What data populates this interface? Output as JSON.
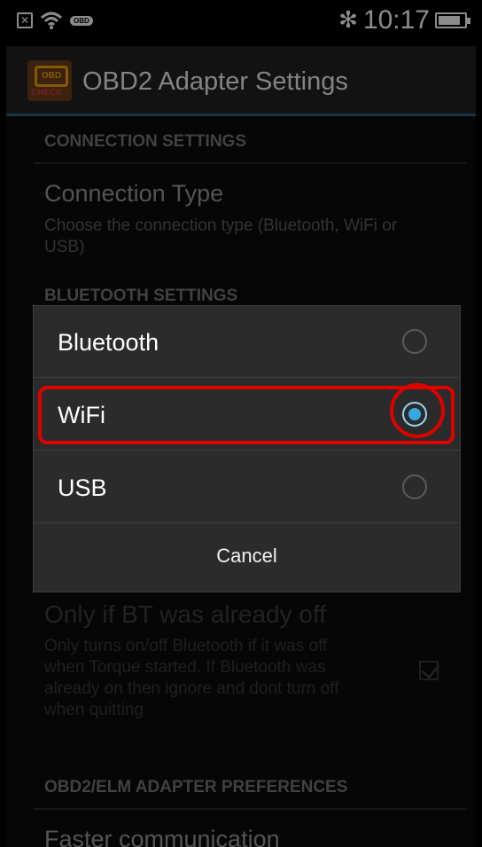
{
  "status_bar": {
    "obd_badge": "OBD",
    "bluetooth_glyph": "✻",
    "time": "10:17",
    "battery_level": 0.85
  },
  "app_bar": {
    "title": "OBD2 Adapter Settings",
    "logo_obd": "OBD",
    "logo_check": "CHECK"
  },
  "settings": {
    "connection_header": "CONNECTION SETTINGS",
    "connection_type_title": "Connection Type",
    "connection_type_desc": "Choose the connection type (Bluetooth, WiFi or USB)",
    "bluetooth_header": "BLUETOOTH SETTINGS",
    "bt_off_title": "Only if BT was already off",
    "bt_off_desc": "Only turns on/off Bluetooth if it was off when Torque started. If Bluetooth was already on then ignore and dont turn off when quitting",
    "bt_off_checked": true,
    "obd2_header": "OBD2/ELM ADAPTER PREFERENCES",
    "faster_comm_title": "Faster communication"
  },
  "dialog": {
    "options": [
      {
        "label": "Bluetooth",
        "selected": false
      },
      {
        "label": "WiFi",
        "selected": true
      },
      {
        "label": "USB",
        "selected": false
      }
    ],
    "cancel_label": "Cancel",
    "highlight_color": "#e00000",
    "radio_accent_color": "#38a8e0"
  }
}
